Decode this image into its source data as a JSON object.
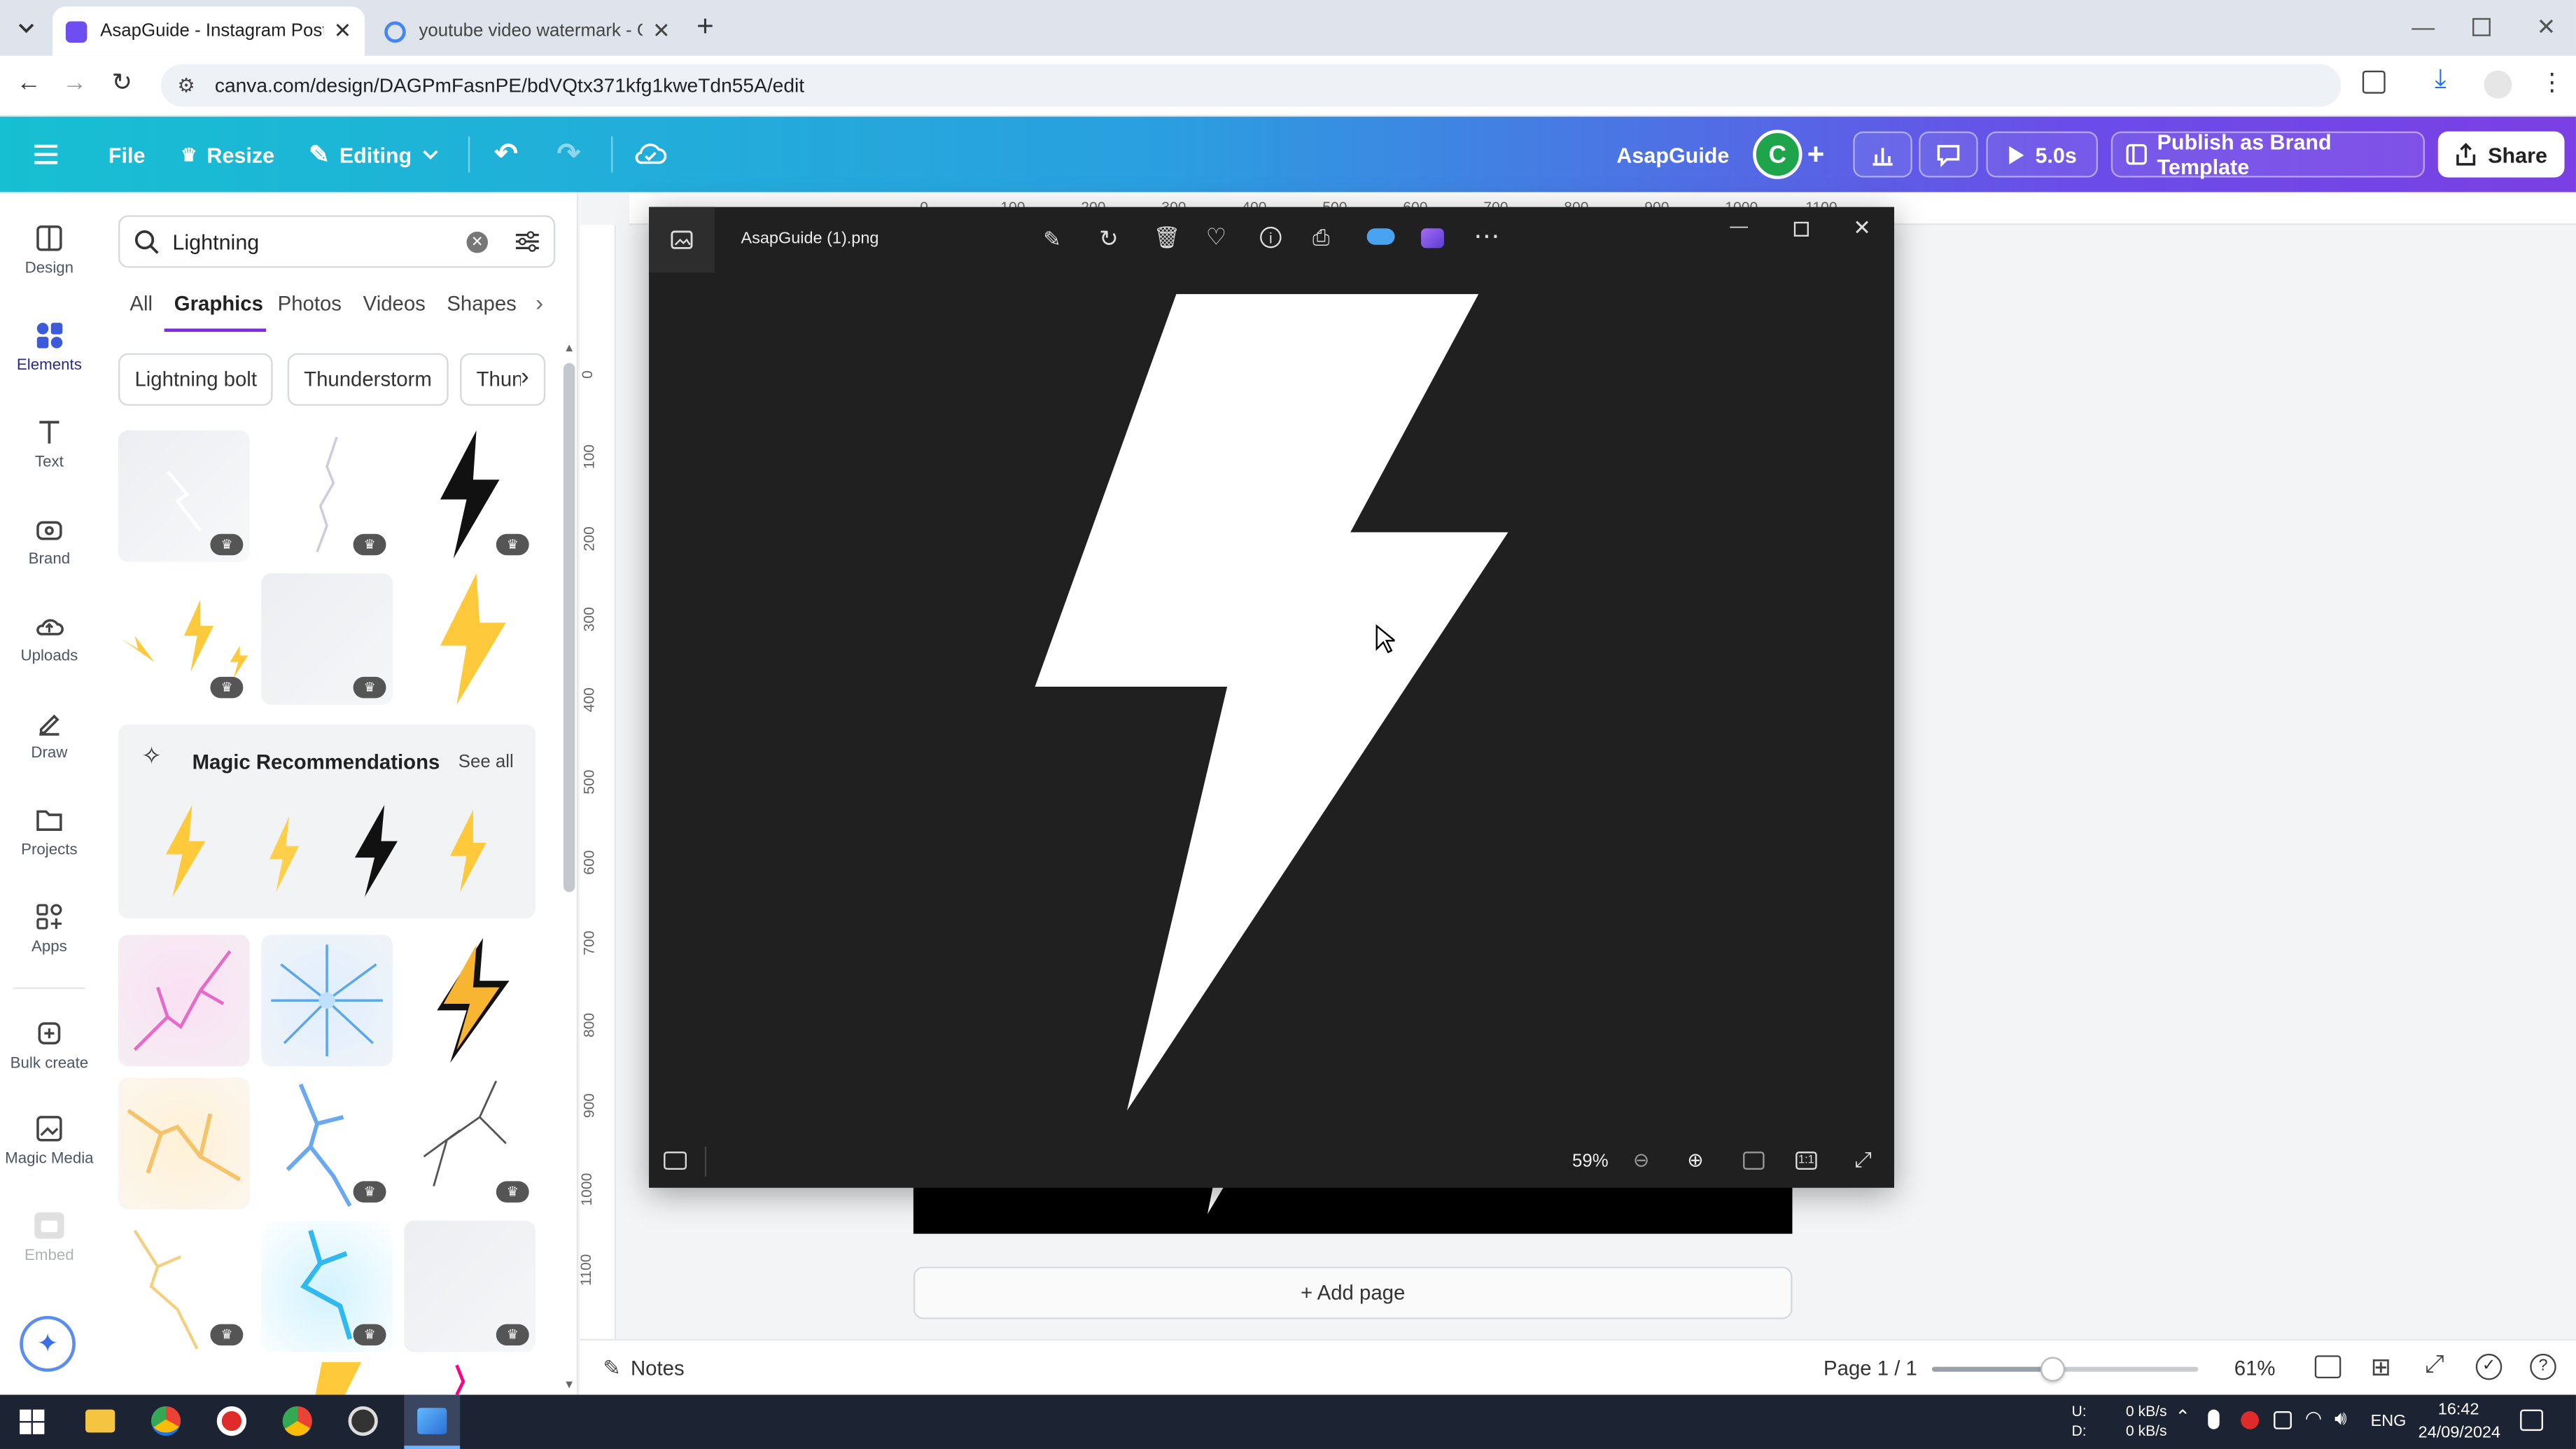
{
  "browser": {
    "tabs": [
      {
        "title": "AsapGuide - Instagram Post - C",
        "active": true
      },
      {
        "title": "youtube video watermark - Goo",
        "active": false
      }
    ],
    "url": "canva.com/design/DAGPmFasnPE/bdVQtx371kfg1kweTdn55A/edit"
  },
  "header": {
    "file": "File",
    "resize": "Resize",
    "editing": "Editing",
    "brand_name": "AsapGuide",
    "avatar": "C",
    "play_duration": "5.0s",
    "publish": "Publish as Brand Template",
    "share": "Share"
  },
  "rail": {
    "items": [
      {
        "label": "Design",
        "icon": "design-icon"
      },
      {
        "label": "Elements",
        "icon": "elements-icon"
      },
      {
        "label": "Text",
        "icon": "text-icon"
      },
      {
        "label": "Brand",
        "icon": "brand-icon"
      },
      {
        "label": "Uploads",
        "icon": "uploads-icon"
      },
      {
        "label": "Draw",
        "icon": "draw-icon"
      },
      {
        "label": "Projects",
        "icon": "projects-icon"
      },
      {
        "label": "Apps",
        "icon": "apps-icon"
      },
      {
        "label": "Bulk create",
        "icon": "bulk-create-icon"
      },
      {
        "label": "Magic Media",
        "icon": "magic-media-icon"
      },
      {
        "label": "Embed",
        "icon": "embed-icon"
      }
    ]
  },
  "panel": {
    "search_value": "Lightning",
    "tabs": [
      "All",
      "Graphics",
      "Photos",
      "Videos",
      "Shapes"
    ],
    "active_tab": "Graphics",
    "chips": [
      "Lightning bolt",
      "Thunderstorm",
      "Thun"
    ],
    "magic_title": "Magic Recommendations",
    "see_all": "See all"
  },
  "ruler": {
    "top": [
      "0",
      "100",
      "200",
      "300",
      "400",
      "500",
      "600",
      "700",
      "800",
      "900",
      "1000",
      "1100"
    ],
    "left": [
      "0",
      "100",
      "200",
      "300",
      "400",
      "500",
      "600",
      "700",
      "800",
      "900",
      "1000",
      "1100"
    ]
  },
  "viewer": {
    "filename": "AsapGuide (1).png",
    "zoom": "59%"
  },
  "canvas": {
    "add_page": "+ Add page"
  },
  "footer": {
    "notes": "Notes",
    "page": "Page 1 / 1",
    "zoom": "61%",
    "zoom_level": 0.45
  },
  "taskbar": {
    "net_up_label": "U:",
    "net_down_label": "D:",
    "net_up": "0 kB/s",
    "net_down": "0 kB/s",
    "lang": "ENG",
    "time": "16:42",
    "date": "24/09/2024"
  },
  "colors": {
    "header_start": "#17bfd2",
    "header_end": "#7b3fe4",
    "accent": "#7d2ae8",
    "bolt_yellow": "#ffc93c",
    "viewer_bg": "#202020"
  }
}
